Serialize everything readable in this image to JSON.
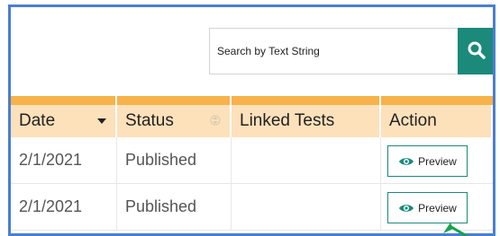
{
  "search": {
    "placeholder": "Search by Text String",
    "button_icon": "search-icon"
  },
  "table": {
    "columns": [
      {
        "label": "Date",
        "sort": "descending"
      },
      {
        "label": "Status",
        "sort": "unsorted"
      },
      {
        "label": "Linked Tests",
        "sort": "none"
      },
      {
        "label": "Action",
        "sort": "none"
      }
    ],
    "rows": [
      {
        "date": "2/1/2021",
        "status": "Published",
        "linked_tests": "",
        "action": "Preview"
      },
      {
        "date": "2/1/2021",
        "status": "Published",
        "linked_tests": "",
        "action": "Preview"
      }
    ]
  },
  "colors": {
    "frame_border": "#4a7fd0",
    "accent": "#1b8a7a",
    "header_strip": "#f7b24a",
    "header_bg": "#fde1bb"
  }
}
